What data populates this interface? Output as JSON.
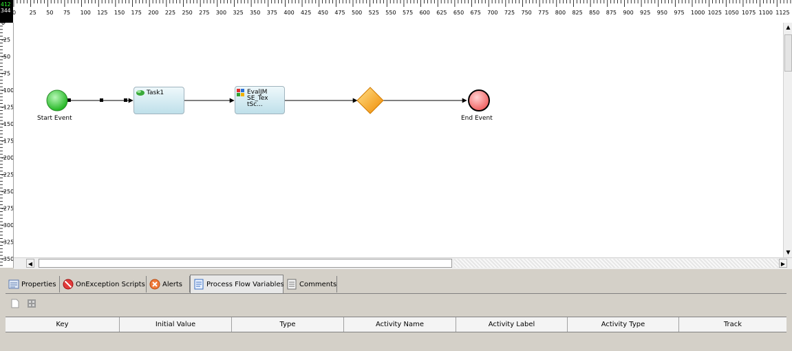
{
  "ruler": {
    "corner_x": "412",
    "corner_y": "344",
    "h_labels": [
      "0",
      "25",
      "50",
      "75",
      "100",
      "125",
      "150",
      "175",
      "200",
      "225",
      "250",
      "275",
      "300",
      "325",
      "350",
      "375",
      "400",
      "425",
      "450",
      "475",
      "500",
      "525",
      "550",
      "575",
      "600",
      "625",
      "650",
      "675",
      "700",
      "725",
      "750",
      "775",
      "800",
      "825",
      "850",
      "875",
      "900",
      "925",
      "950",
      "975",
      "1000",
      "1025",
      "1050",
      "1075",
      "1100",
      "1125"
    ],
    "v_labels": [
      "0",
      "-25",
      "-50",
      "-75",
      "-100",
      "-125",
      "-150",
      "-175",
      "-200",
      "-225",
      "-250",
      "-275",
      "-300",
      "-325",
      "-350"
    ]
  },
  "diagram": {
    "start_event_label": "Start Event",
    "task1_label": "Task1",
    "task2_label": "EvalJM\nSE_Tex\ntSc...",
    "end_event_label": "End Event",
    "colors": {
      "start": "#33cc33",
      "end": "#ff6b6b",
      "gateway": "#f5a623",
      "task_fill": "#c8e6ee"
    }
  },
  "tabs": [
    {
      "label": "Properties",
      "icon": "properties-icon"
    },
    {
      "label": "OnException Scripts",
      "icon": "no-entry-icon"
    },
    {
      "label": "Alerts",
      "icon": "alert-error-icon"
    },
    {
      "label": "Process Flow Variables",
      "icon": "variables-icon",
      "active": true
    },
    {
      "label": "Comments",
      "icon": "comments-icon"
    }
  ],
  "toolbar": {
    "new_icon": "new-document-icon",
    "delete_icon": "delete-grid-icon"
  },
  "table": {
    "columns": [
      "Key",
      "Initial Value",
      "Type",
      "Activity Name",
      "Activity Label",
      "Activity Type",
      "Track"
    ]
  }
}
